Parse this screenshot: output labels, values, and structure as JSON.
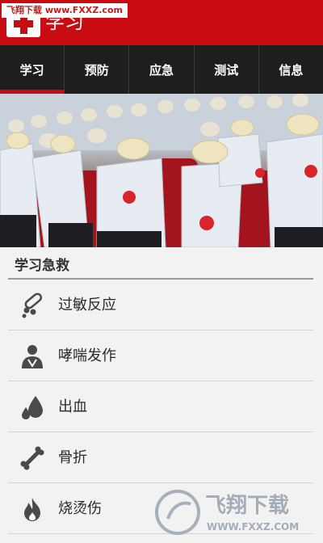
{
  "watermark_top": {
    "brand": "飞翔下载",
    "url": "www.FXXZ.com"
  },
  "header": {
    "title": "学习"
  },
  "nav": {
    "tabs": [
      {
        "label": "学习",
        "active": true
      },
      {
        "label": "预防",
        "active": false
      },
      {
        "label": "应急",
        "active": false
      },
      {
        "label": "测试",
        "active": false
      },
      {
        "label": "信息",
        "active": false
      }
    ]
  },
  "section": {
    "title": "学习急救"
  },
  "list": {
    "items": [
      {
        "label": "过敏反应",
        "icon": "pills-icon"
      },
      {
        "label": "哮喘发作",
        "icon": "person-icon"
      },
      {
        "label": "出血",
        "icon": "blood-drop-icon"
      },
      {
        "label": "骨折",
        "icon": "bone-icon"
      },
      {
        "label": "烧烫伤",
        "icon": "flame-icon"
      }
    ]
  },
  "watermark_bottom": {
    "brand": "飞翔下载",
    "url": "WWW.FXXZ.COM"
  },
  "colors": {
    "brand_red": "#c90c12",
    "nav_bg": "#1e1e1e"
  }
}
